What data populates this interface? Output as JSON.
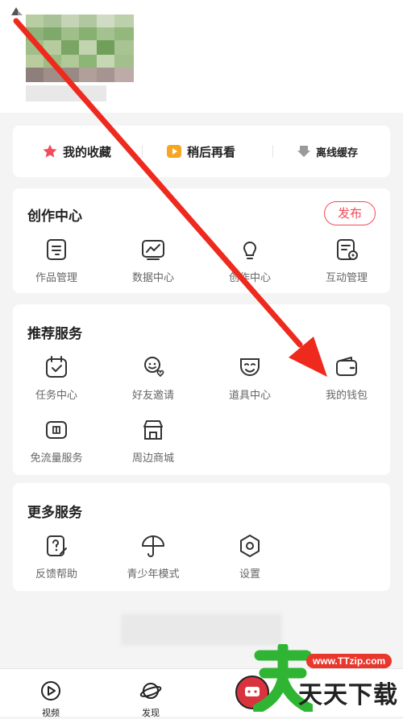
{
  "quick_actions": [
    {
      "label": "我的收藏",
      "icon": "star-icon"
    },
    {
      "label": "稍后再看",
      "icon": "play-later-icon"
    },
    {
      "label": "离线缓存",
      "icon": "download-icon"
    }
  ],
  "creation": {
    "title": "创作中心",
    "publish_label": "发布",
    "items": [
      {
        "label": "作品管理",
        "icon": "works-icon"
      },
      {
        "label": "数据中心",
        "icon": "chart-icon"
      },
      {
        "label": "创作中心",
        "icon": "lightbulb-icon"
      },
      {
        "label": "互动管理",
        "icon": "interaction-icon"
      }
    ]
  },
  "recommended": {
    "title": "推荐服务",
    "items": [
      {
        "label": "任务中心",
        "icon": "calendar-task-icon"
      },
      {
        "label": "好友邀请",
        "icon": "invite-friend-icon"
      },
      {
        "label": "道具中心",
        "icon": "mask-icon"
      },
      {
        "label": "我的钱包",
        "icon": "wallet-icon"
      },
      {
        "label": "免流量服务",
        "icon": "sim-card-icon"
      },
      {
        "label": "周边商城",
        "icon": "shop-icon"
      }
    ]
  },
  "more": {
    "title": "更多服务",
    "items": [
      {
        "label": "反馈帮助",
        "icon": "feedback-icon"
      },
      {
        "label": "青少年模式",
        "icon": "umbrella-icon"
      },
      {
        "label": "设置",
        "icon": "settings-icon"
      }
    ]
  },
  "tabbar": [
    {
      "label": "视频",
      "icon": "video-tab-icon"
    },
    {
      "label": "发现",
      "icon": "planet-tab-icon"
    }
  ],
  "watermark": {
    "site": "www.TTzip.com",
    "text": "天天下载"
  },
  "colors": {
    "accent": "#f24b5a",
    "orange": "#f5a623",
    "arrow": "#ee2a1e",
    "watermark_green": "#2fb533"
  }
}
